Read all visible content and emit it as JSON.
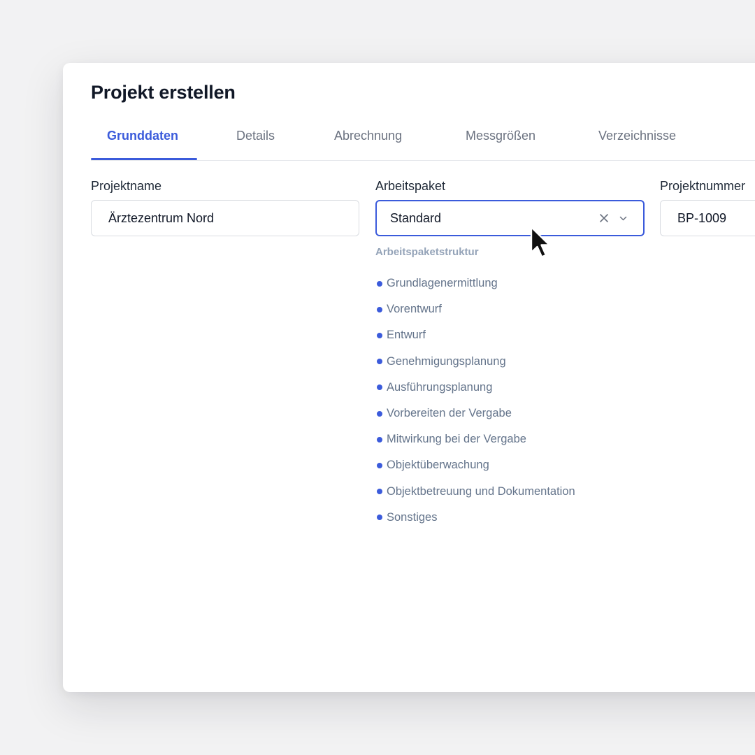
{
  "dialog": {
    "title": "Projekt erstellen"
  },
  "tabs": [
    {
      "label": "Grunddaten",
      "active": true
    },
    {
      "label": "Details",
      "active": false
    },
    {
      "label": "Abrechnung",
      "active": false
    },
    {
      "label": "Messgrößen",
      "active": false
    },
    {
      "label": "Verzeichnisse",
      "active": false
    }
  ],
  "fields": {
    "projektname": {
      "label": "Projektname",
      "value": "Ärztezentrum Nord"
    },
    "arbeitspaket": {
      "label": "Arbeitspaket",
      "value": "Standard",
      "clear_icon": "close-icon",
      "dropdown_icon": "chevron-down-icon"
    },
    "projektnummer": {
      "label": "Projektnummer",
      "value": "BP-1009"
    }
  },
  "structure": {
    "heading": "Arbeitspaketstruktur",
    "items": [
      "Grundlagenermittlung",
      "Vorentwurf",
      "Entwurf",
      "Genehmigungsplanung",
      "Ausführungsplanung",
      "Vorbereiten der Vergabe",
      "Mitwirkung bei der Vergabe",
      "Objektüberwachung",
      "Objektbetreuung und Dokumentation",
      "Sonstiges"
    ]
  },
  "colors": {
    "accent": "#3b5bdb",
    "background": "#f2f2f3",
    "muted_text": "#64748b"
  }
}
